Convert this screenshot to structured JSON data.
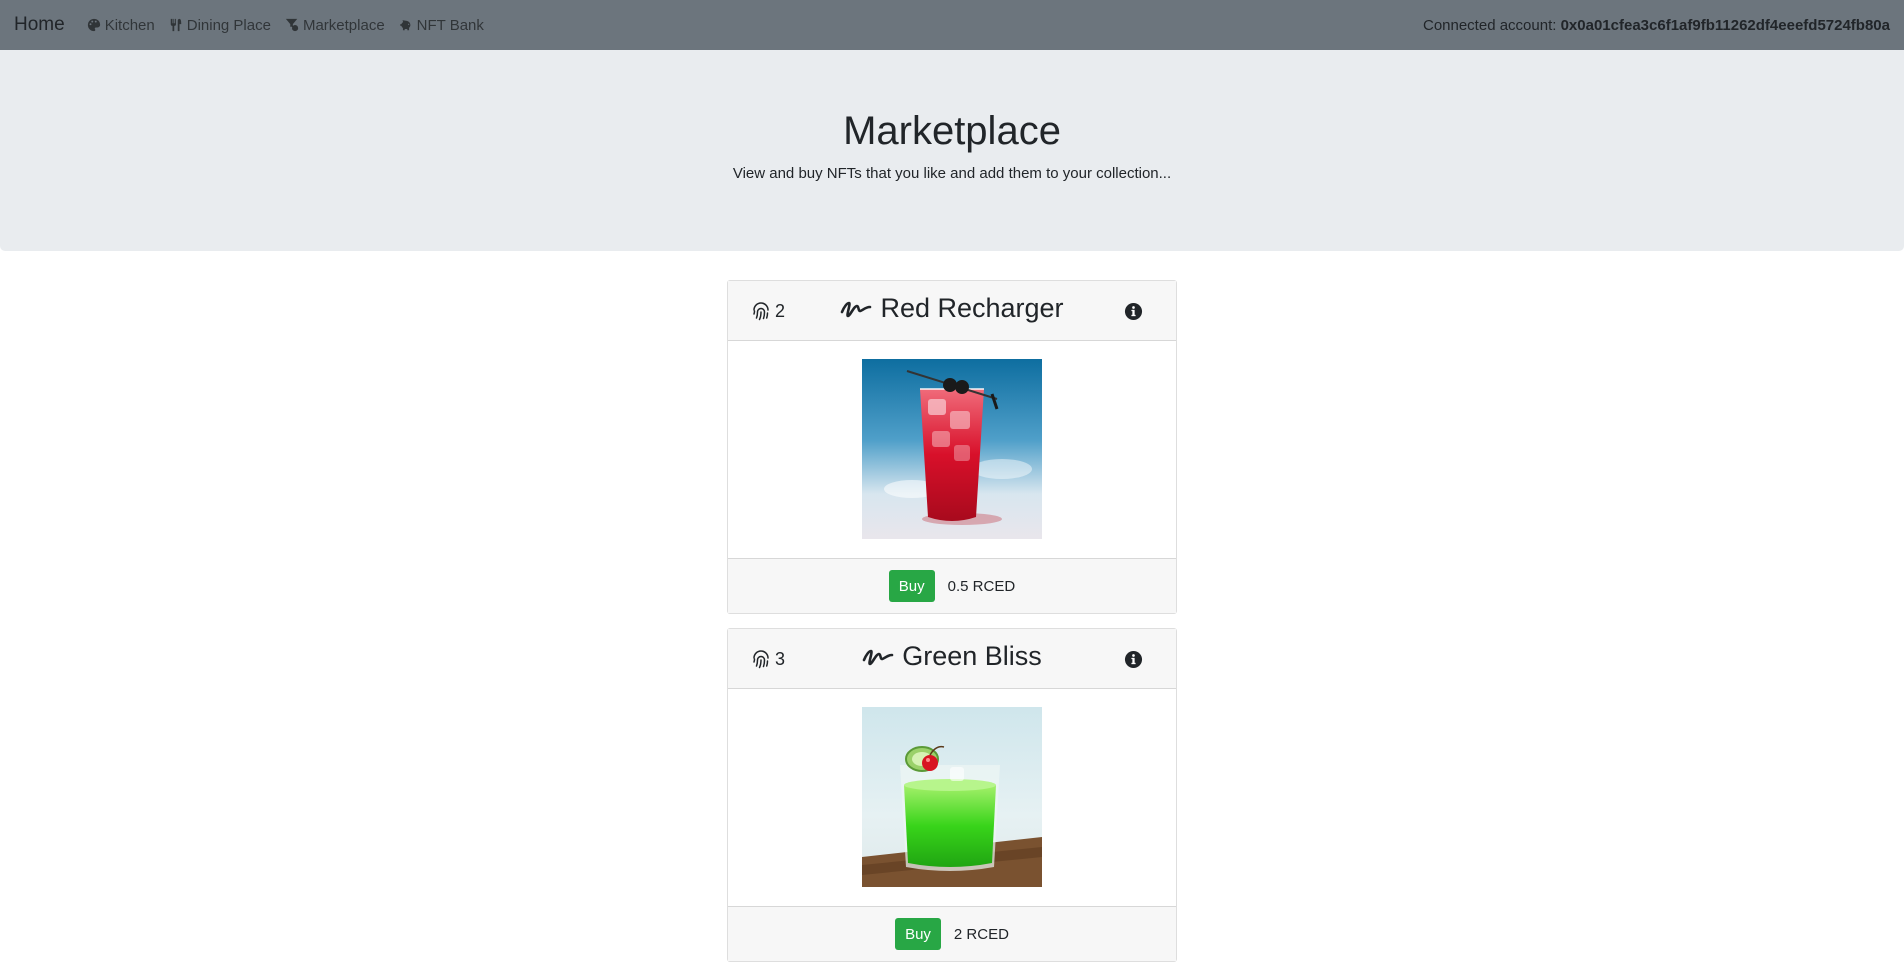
{
  "navbar": {
    "brand": "Home",
    "items": [
      {
        "label": "Kitchen",
        "icon": "palette-icon"
      },
      {
        "label": "Dining Place",
        "icon": "utensils-icon"
      },
      {
        "label": "Marketplace",
        "icon": "filter-dollar-icon"
      },
      {
        "label": "NFT Bank",
        "icon": "piggy-bank-icon"
      }
    ],
    "account_label": "Connected account:",
    "account_address": "0x0a01cfea3c6f1af9fb11262df4eeefd5724fb80a"
  },
  "header": {
    "title": "Marketplace",
    "subtitle": "View and buy NFTs that you like and add them to your collection..."
  },
  "cards": [
    {
      "token_id": "2",
      "name": "Red Recharger",
      "buy_label": "Buy",
      "price": "0.5 RCED",
      "image": "red cocktail with cherries and ice"
    },
    {
      "token_id": "3",
      "name": "Green Bliss",
      "buy_label": "Buy",
      "price": "2 RCED",
      "image": "green cocktail with cherry and cucumber"
    }
  ],
  "colors": {
    "navbar": "#6c757d",
    "jumbotron": "#e9ecef",
    "buy_button": "#28a745"
  }
}
